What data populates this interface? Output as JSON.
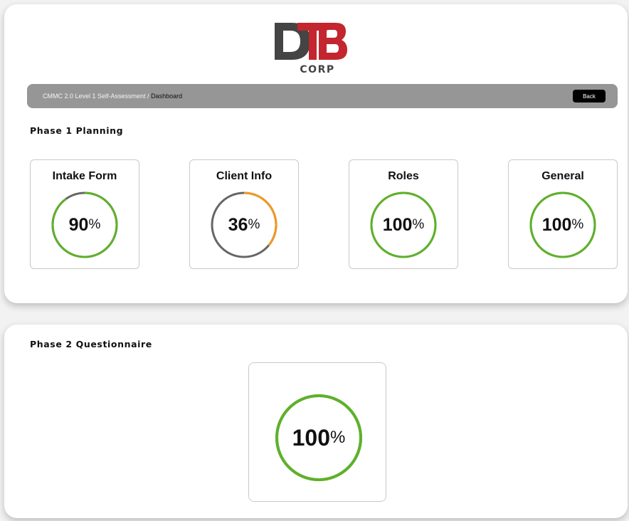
{
  "logo": {
    "letters": "DTB",
    "sub": "CORP",
    "colors": {
      "d": "#444444",
      "tb": "#c3262f"
    }
  },
  "breadcrumb": {
    "path": "CMMC 2.0 Level 1 Self-Assessment / ",
    "current": "Dashboard",
    "back_label": "Back"
  },
  "colors": {
    "complete": "#5fb02c",
    "progress": "#ef9a22",
    "track": "#666666",
    "bar": "#969696"
  },
  "phase1": {
    "title": "Phase 1 Planning",
    "cards": [
      {
        "title": "Intake Form",
        "percent": 90,
        "value_text": "90",
        "unit": "%"
      },
      {
        "title": "Client Info",
        "percent": 36,
        "value_text": "36",
        "unit": "%"
      },
      {
        "title": "Roles",
        "percent": 100,
        "value_text": "100",
        "unit": "%"
      },
      {
        "title": "General",
        "percent": 100,
        "value_text": "100",
        "unit": "%"
      }
    ]
  },
  "phase2": {
    "title": "Phase 2 Questionnaire",
    "card": {
      "percent": 100,
      "value_text": "100",
      "unit": "%"
    }
  }
}
